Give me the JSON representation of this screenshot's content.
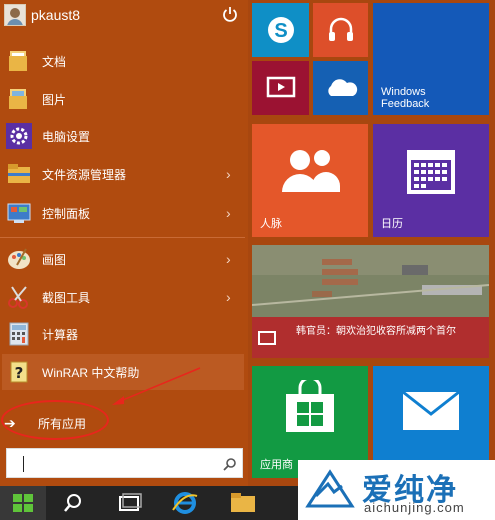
{
  "user": {
    "name": "pkaust8"
  },
  "menu": {
    "items": [
      {
        "label": "文档",
        "icon": "folder-document-icon",
        "has_chevron": false
      },
      {
        "label": "图片",
        "icon": "folder-pictures-icon",
        "has_chevron": false
      },
      {
        "label": "电脑设置",
        "icon": "settings-gear-icon",
        "has_chevron": false
      },
      {
        "label": "文件资源管理器",
        "icon": "file-explorer-icon",
        "has_chevron": true
      },
      {
        "label": "控制面板",
        "icon": "control-panel-icon",
        "has_chevron": true
      },
      {
        "label": "画图",
        "icon": "paint-palette-icon",
        "has_chevron": true
      },
      {
        "label": "截图工具",
        "icon": "scissors-icon",
        "has_chevron": true
      },
      {
        "label": "计算器",
        "icon": "calculator-icon",
        "has_chevron": false
      },
      {
        "label": "WinRAR 中文帮助",
        "icon": "help-book-icon",
        "has_chevron": false
      }
    ],
    "all_apps_label": "所有应用"
  },
  "tiles": {
    "skype": {
      "label": ""
    },
    "music": {
      "label": ""
    },
    "video": {
      "label": ""
    },
    "onedrive": {
      "label": ""
    },
    "feedback": {
      "label": "Windows\nFeedback"
    },
    "people": {
      "label": "人脉"
    },
    "calendar": {
      "label": "日历"
    },
    "news": {
      "label": "",
      "headline": "韩官员：朝欢治犯收容所减两个首尔"
    },
    "store": {
      "label": "应用商"
    },
    "mail": {
      "label": ""
    }
  },
  "watermark": {
    "title": "爱纯净",
    "url": "aichunjing.com"
  },
  "colors": {
    "start_background": "#b04b0f",
    "annotation_red": "#e8261c",
    "tile_blue": "#1459b8",
    "tile_orange": "#e4572a",
    "tile_purple": "#5b2fa3",
    "tile_green": "#129a43"
  }
}
